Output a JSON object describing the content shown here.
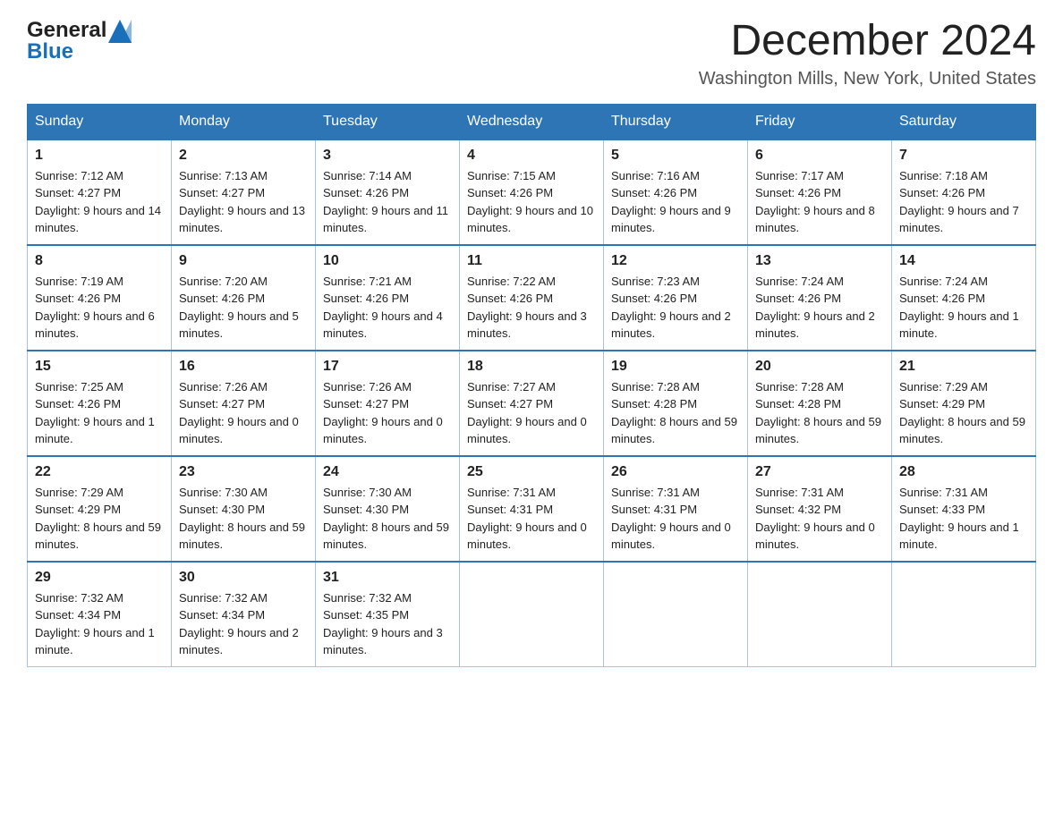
{
  "logo": {
    "general": "General",
    "blue": "Blue"
  },
  "header": {
    "month": "December 2024",
    "location": "Washington Mills, New York, United States"
  },
  "weekdays": [
    "Sunday",
    "Monday",
    "Tuesday",
    "Wednesday",
    "Thursday",
    "Friday",
    "Saturday"
  ],
  "weeks": [
    [
      {
        "day": "1",
        "sunrise": "7:12 AM",
        "sunset": "4:27 PM",
        "daylight": "9 hours and 14 minutes."
      },
      {
        "day": "2",
        "sunrise": "7:13 AM",
        "sunset": "4:27 PM",
        "daylight": "9 hours and 13 minutes."
      },
      {
        "day": "3",
        "sunrise": "7:14 AM",
        "sunset": "4:26 PM",
        "daylight": "9 hours and 11 minutes."
      },
      {
        "day": "4",
        "sunrise": "7:15 AM",
        "sunset": "4:26 PM",
        "daylight": "9 hours and 10 minutes."
      },
      {
        "day": "5",
        "sunrise": "7:16 AM",
        "sunset": "4:26 PM",
        "daylight": "9 hours and 9 minutes."
      },
      {
        "day": "6",
        "sunrise": "7:17 AM",
        "sunset": "4:26 PM",
        "daylight": "9 hours and 8 minutes."
      },
      {
        "day": "7",
        "sunrise": "7:18 AM",
        "sunset": "4:26 PM",
        "daylight": "9 hours and 7 minutes."
      }
    ],
    [
      {
        "day": "8",
        "sunrise": "7:19 AM",
        "sunset": "4:26 PM",
        "daylight": "9 hours and 6 minutes."
      },
      {
        "day": "9",
        "sunrise": "7:20 AM",
        "sunset": "4:26 PM",
        "daylight": "9 hours and 5 minutes."
      },
      {
        "day": "10",
        "sunrise": "7:21 AM",
        "sunset": "4:26 PM",
        "daylight": "9 hours and 4 minutes."
      },
      {
        "day": "11",
        "sunrise": "7:22 AM",
        "sunset": "4:26 PM",
        "daylight": "9 hours and 3 minutes."
      },
      {
        "day": "12",
        "sunrise": "7:23 AM",
        "sunset": "4:26 PM",
        "daylight": "9 hours and 2 minutes."
      },
      {
        "day": "13",
        "sunrise": "7:24 AM",
        "sunset": "4:26 PM",
        "daylight": "9 hours and 2 minutes."
      },
      {
        "day": "14",
        "sunrise": "7:24 AM",
        "sunset": "4:26 PM",
        "daylight": "9 hours and 1 minute."
      }
    ],
    [
      {
        "day": "15",
        "sunrise": "7:25 AM",
        "sunset": "4:26 PM",
        "daylight": "9 hours and 1 minute."
      },
      {
        "day": "16",
        "sunrise": "7:26 AM",
        "sunset": "4:27 PM",
        "daylight": "9 hours and 0 minutes."
      },
      {
        "day": "17",
        "sunrise": "7:26 AM",
        "sunset": "4:27 PM",
        "daylight": "9 hours and 0 minutes."
      },
      {
        "day": "18",
        "sunrise": "7:27 AM",
        "sunset": "4:27 PM",
        "daylight": "9 hours and 0 minutes."
      },
      {
        "day": "19",
        "sunrise": "7:28 AM",
        "sunset": "4:28 PM",
        "daylight": "8 hours and 59 minutes."
      },
      {
        "day": "20",
        "sunrise": "7:28 AM",
        "sunset": "4:28 PM",
        "daylight": "8 hours and 59 minutes."
      },
      {
        "day": "21",
        "sunrise": "7:29 AM",
        "sunset": "4:29 PM",
        "daylight": "8 hours and 59 minutes."
      }
    ],
    [
      {
        "day": "22",
        "sunrise": "7:29 AM",
        "sunset": "4:29 PM",
        "daylight": "8 hours and 59 minutes."
      },
      {
        "day": "23",
        "sunrise": "7:30 AM",
        "sunset": "4:30 PM",
        "daylight": "8 hours and 59 minutes."
      },
      {
        "day": "24",
        "sunrise": "7:30 AM",
        "sunset": "4:30 PM",
        "daylight": "8 hours and 59 minutes."
      },
      {
        "day": "25",
        "sunrise": "7:31 AM",
        "sunset": "4:31 PM",
        "daylight": "9 hours and 0 minutes."
      },
      {
        "day": "26",
        "sunrise": "7:31 AM",
        "sunset": "4:31 PM",
        "daylight": "9 hours and 0 minutes."
      },
      {
        "day": "27",
        "sunrise": "7:31 AM",
        "sunset": "4:32 PM",
        "daylight": "9 hours and 0 minutes."
      },
      {
        "day": "28",
        "sunrise": "7:31 AM",
        "sunset": "4:33 PM",
        "daylight": "9 hours and 1 minute."
      }
    ],
    [
      {
        "day": "29",
        "sunrise": "7:32 AM",
        "sunset": "4:34 PM",
        "daylight": "9 hours and 1 minute."
      },
      {
        "day": "30",
        "sunrise": "7:32 AM",
        "sunset": "4:34 PM",
        "daylight": "9 hours and 2 minutes."
      },
      {
        "day": "31",
        "sunrise": "7:32 AM",
        "sunset": "4:35 PM",
        "daylight": "9 hours and 3 minutes."
      },
      null,
      null,
      null,
      null
    ]
  ],
  "labels": {
    "sunrise": "Sunrise:",
    "sunset": "Sunset:",
    "daylight": "Daylight:"
  }
}
